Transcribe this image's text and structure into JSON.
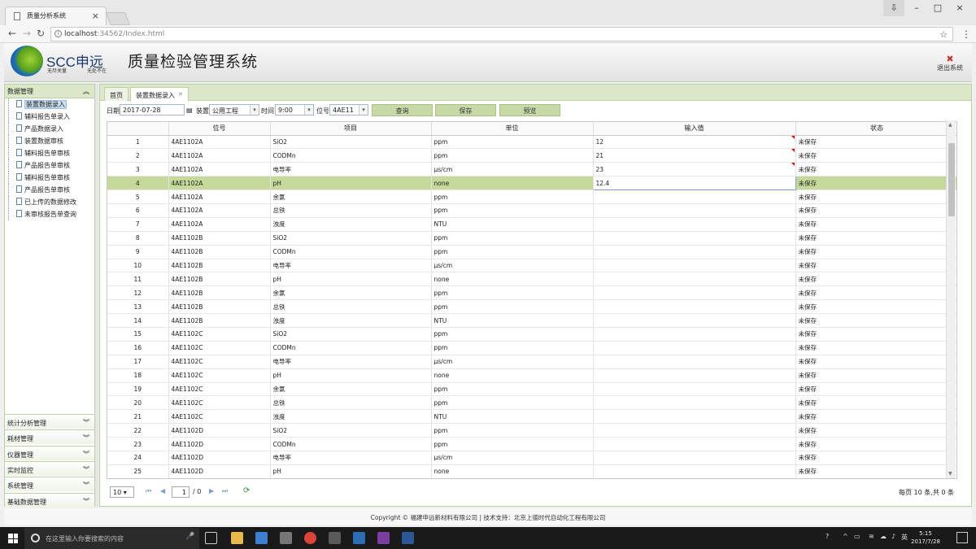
{
  "browser": {
    "tab_title": "质量分析系统",
    "url_host": "localhost",
    "url_rest": ":34562/Index.html"
  },
  "header": {
    "brand": "SCC申远",
    "slogan1": "无尽关量",
    "slogan2": "无处不在",
    "title": "质量检验管理系统",
    "logout": "退出系统"
  },
  "sidebar": {
    "section": "数据管理",
    "items": [
      "装置数据录入",
      "辅料报告单录入",
      "产品数据录入",
      "装置数据审核",
      "辅料报告单审核",
      "产品报告单审核",
      "辅料报告单审核",
      "产品报告单审核",
      "已上传的数据修改",
      "未审核报告单查询"
    ],
    "groups": [
      "统计分析管理",
      "耗材管理",
      "仪器管理",
      "实时监控",
      "系统管理",
      "基础数据管理"
    ]
  },
  "main": {
    "tabs": [
      "首页",
      "装置数据录入"
    ],
    "toolbar": {
      "date_label": "日期",
      "date": "2017-07-28",
      "device_label": "装置",
      "device": "公用工程",
      "time_label": "时间",
      "time": "9:00",
      "pos_label": "位号",
      "pos": "4AE11",
      "query": "查询",
      "save": "保存",
      "preview": "预览"
    },
    "columns": [
      "",
      "位号",
      "项目",
      "单位",
      "输入值",
      "状态"
    ],
    "rows": [
      [
        "1",
        "4AE1102A",
        "SiO2",
        "ppm",
        "12",
        "未保存"
      ],
      [
        "2",
        "4AE1102A",
        "CODMn",
        "ppm",
        "21",
        "未保存"
      ],
      [
        "3",
        "4AE1102A",
        "电导率",
        "μs/cm",
        "23",
        "未保存"
      ],
      [
        "4",
        "4AE1102A",
        "pH",
        "none",
        "12.4",
        "未保存"
      ],
      [
        "5",
        "4AE1102A",
        "余氯",
        "ppm",
        "",
        "未保存"
      ],
      [
        "6",
        "4AE1102A",
        "总铁",
        "ppm",
        "",
        "未保存"
      ],
      [
        "7",
        "4AE1102A",
        "浊度",
        "NTU",
        "",
        "未保存"
      ],
      [
        "8",
        "4AE1102B",
        "SiO2",
        "ppm",
        "",
        "未保存"
      ],
      [
        "9",
        "4AE1102B",
        "CODMn",
        "ppm",
        "",
        "未保存"
      ],
      [
        "10",
        "4AE1102B",
        "电导率",
        "μs/cm",
        "",
        "未保存"
      ],
      [
        "11",
        "4AE1102B",
        "pH",
        "none",
        "",
        "未保存"
      ],
      [
        "12",
        "4AE1102B",
        "余氯",
        "ppm",
        "",
        "未保存"
      ],
      [
        "13",
        "4AE1102B",
        "总铁",
        "ppm",
        "",
        "未保存"
      ],
      [
        "14",
        "4AE1102B",
        "浊度",
        "NTU",
        "",
        "未保存"
      ],
      [
        "15",
        "4AE1102C",
        "SiO2",
        "ppm",
        "",
        "未保存"
      ],
      [
        "16",
        "4AE1102C",
        "CODMn",
        "ppm",
        "",
        "未保存"
      ],
      [
        "17",
        "4AE1102C",
        "电导率",
        "μs/cm",
        "",
        "未保存"
      ],
      [
        "18",
        "4AE1102C",
        "pH",
        "none",
        "",
        "未保存"
      ],
      [
        "19",
        "4AE1102C",
        "余氯",
        "ppm",
        "",
        "未保存"
      ],
      [
        "20",
        "4AE1102C",
        "总铁",
        "ppm",
        "",
        "未保存"
      ],
      [
        "21",
        "4AE1102C",
        "浊度",
        "NTU",
        "",
        "未保存"
      ],
      [
        "22",
        "4AE1102D",
        "SiO2",
        "ppm",
        "",
        "未保存"
      ],
      [
        "23",
        "4AE1102D",
        "CODMn",
        "ppm",
        "",
        "未保存"
      ],
      [
        "24",
        "4AE1102D",
        "电导率",
        "μs/cm",
        "",
        "未保存"
      ],
      [
        "25",
        "4AE1102D",
        "pH",
        "none",
        "",
        "未保存"
      ]
    ],
    "selected_row": 4,
    "edited_rows": [
      1,
      2,
      3
    ],
    "pager": {
      "page_size": "10",
      "page": "1",
      "total_pages": "/ 0",
      "info": "每页 10 条,共 0 条"
    }
  },
  "footer": "Copyright © 福建申远新材料有限公司 | 技术支持：北京上德时代自动化工程有限公司",
  "taskbar": {
    "search_placeholder": "在这里输入你要搜索的内容",
    "time": "5:15",
    "date": "2017/7/28",
    "ime": "英"
  },
  "colors": {
    "accent_green": "#c4d99a",
    "panel_green": "#dce8c8",
    "border": "#bcd0a3"
  }
}
